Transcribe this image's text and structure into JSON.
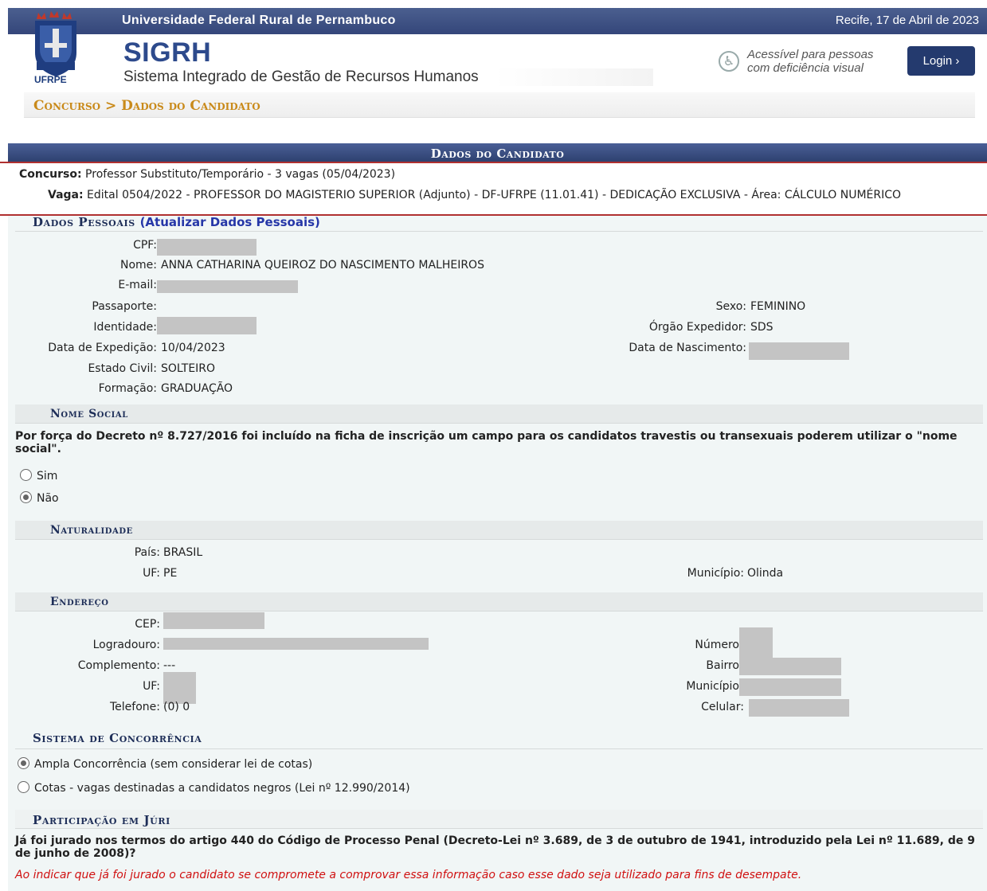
{
  "header": {
    "university": "Universidade Federal Rural de Pernambuco",
    "date": "Recife, 17 de Abril de 2023",
    "logo_text": "UFRPE",
    "system_short": "SIGRH",
    "system_full": "Sistema Integrado de Gestão de Recursos Humanos",
    "accessibility_line1": "Acessível para pessoas",
    "accessibility_line2": "com deficiência visual",
    "login_label": "Login  ›"
  },
  "breadcrumb": "Concurso > Dados do Candidato",
  "panel_title": "Dados do Candidato",
  "concurso": {
    "label": "Concurso:",
    "value": "Professor Substituto/Temporário - 3 vagas (05/04/2023)",
    "vaga_label": "Vaga:",
    "vaga_value": "Edital 0504/2022 - PROFESSOR DO MAGISTERIO SUPERIOR (Adjunto) - DF-UFRPE (11.01.41) - DEDICAÇÃO EXCLUSIVA - Área: CÁLCULO NUMÉRICO"
  },
  "dados_pessoais": {
    "title": "Dados Pessoais",
    "update_link": "(Atualizar Dados Pessoais)",
    "cpf_label": "CPF:",
    "nome_label": "Nome:",
    "nome_value": "ANNA CATHARINA QUEIROZ DO NASCIMENTO MALHEIROS",
    "email_label": "E-mail:",
    "passaporte_label": "Passaporte:",
    "sexo_label": "Sexo:",
    "sexo_value": "FEMININO",
    "identidade_label": "Identidade:",
    "orgao_label": "Órgão Expedidor:",
    "orgao_value": "SDS",
    "data_exp_label": "Data de Expedição:",
    "data_exp_value": "10/04/2023",
    "nascimento_label": "Data de Nascimento:",
    "estado_civil_label": "Estado Civil:",
    "estado_civil_value": "SOLTEIRO",
    "formacao_label": "Formação:",
    "formacao_value": "GRADUAÇÃO"
  },
  "nome_social": {
    "title": "Nome Social",
    "text": "Por força do Decreto nº 8.727/2016 foi incluído na ficha de inscrição um campo para os candidatos travestis ou transexuais poderem utilizar o \"nome social\".",
    "option_sim": "Sim",
    "option_nao": "Não",
    "selected": "Não"
  },
  "naturalidade": {
    "title": "Naturalidade",
    "pais_label": "País:",
    "pais_value": "BRASIL",
    "uf_label": "UF:",
    "uf_value": "PE",
    "municipio_label": "Município:",
    "municipio_value": "Olinda"
  },
  "endereco": {
    "title": "Endereço",
    "cep_label": "CEP:",
    "logradouro_label": "Logradouro:",
    "numero_label": "Número",
    "complemento_label": "Complemento:",
    "complemento_value": "---",
    "bairro_label": "Bairro",
    "uf_label": "UF:",
    "municipio_label": "Município",
    "telefone_label": "Telefone:",
    "telefone_value": "(0) 0",
    "celular_label": "Celular:"
  },
  "concorrencia": {
    "title": "Sistema de Concorrência",
    "option_ampla": "Ampla Concorrência (sem considerar lei de cotas)",
    "option_cotas": "Cotas - vagas destinadas a candidatos negros (Lei nº 12.990/2014)",
    "selected": "Ampla Concorrência (sem considerar lei de cotas)"
  },
  "juri": {
    "title": "Participação em Júri",
    "question": "Já foi jurado nos termos do artigo 440 do Código de Processo Penal (Decreto-Lei nº 3.689, de 3 de outubro de 1941, introduzido pela Lei nº 11.689, de 9 de junho de 2008)?",
    "warning": "Ao indicar que já foi jurado o candidato se compromete a comprovar essa informação caso esse dado seja utilizado para fins de desempate."
  }
}
